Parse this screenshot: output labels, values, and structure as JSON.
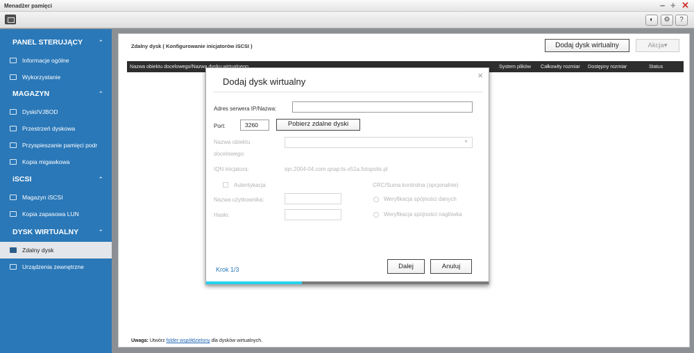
{
  "window": {
    "title": "Menadżer pamięci"
  },
  "toolbar": {
    "btn1_icon": "lock-icon",
    "btn2_icon": "gear-icon",
    "btn3_label": "?"
  },
  "sidebar": {
    "sections": [
      {
        "title": "PANEL STERUJĄCY",
        "items": [
          "Informacje ogólne",
          "Wykorzystanie"
        ]
      },
      {
        "title": "MAGAZYN",
        "items": [
          "Dyski/VJBOD",
          "Przestrzeń dyskowa",
          "Przyspieszanie pamięci podr",
          "Kopia migawkowa"
        ]
      },
      {
        "title": "iSCSI",
        "items": [
          "Magazyn iSCSI",
          "Kopia zapasowa LUN"
        ]
      },
      {
        "title": "DYSK WIRTUALNY",
        "items": [
          "Zdalny dysk",
          "Urządzenia zewnętrzne"
        ]
      }
    ],
    "active_item": "Zdalny dysk"
  },
  "main": {
    "breadcrumb": "Zdalny dysk ( Konfigurowanie inicjatorów iSCSI )",
    "add_button": "Dodaj dysk wirtualny",
    "action_button": "Akcja▾",
    "columns": [
      "Nazwa obiektu docelowego/Nazwa dysku wirtualnego",
      "System plików",
      "Całkowity rozmiar",
      "Dostępny rozmiar",
      "Status"
    ],
    "footnote": {
      "prefix": "Uwaga:",
      "text_before": " Utwórz ",
      "link": "folder współdzielony",
      "text_after": " dla dysków wirtualnych."
    }
  },
  "modal": {
    "title": "Dodaj dysk wirtualny",
    "server_label": "Adres serwera IP/Nazwa:",
    "server_value": "",
    "port_label": "Port:",
    "port_value": "3260",
    "fetch_button": "Pobierz zdalne dyski",
    "target_label_1": "Nazwa obiektu",
    "target_label_2": "docelowego:",
    "iqn_label": "IQN inicjatora:",
    "iqn_value": "iqn.2004-04.com.qnap:ts-x51a.fotopolis.pl",
    "auth_label": "Autentykacja",
    "crc_label": "CRC/Suma kontrolna (opcjonalnie)",
    "username_label": "Nazwa użytkownika:",
    "password_label": "Hasło:",
    "data_check_label": "Weryfikacja spójności danych",
    "header_check_label": "Weryfikacja spójności nagłówka",
    "step": "Krok 1/3",
    "next_button": "Dalej",
    "cancel_button": "Anuluj",
    "progress": 0.34
  },
  "colors": {
    "sidebar": "#2a78b8",
    "accent": "#27d2ee",
    "close": "#d03030"
  }
}
